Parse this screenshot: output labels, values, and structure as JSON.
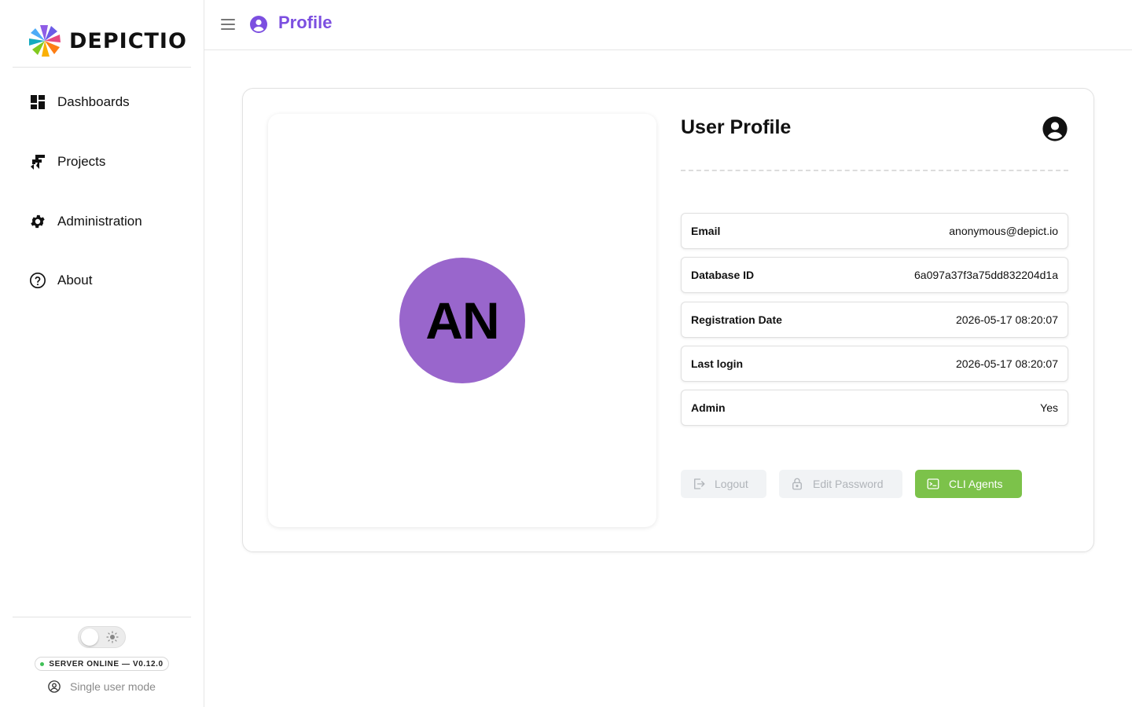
{
  "brand": {
    "name": "DEPICTIO"
  },
  "header": {
    "title": "Profile"
  },
  "sidebar": {
    "items": [
      {
        "label": "Dashboards",
        "icon": "dashboard-icon"
      },
      {
        "label": "Projects",
        "icon": "projects-icon"
      },
      {
        "label": "Administration",
        "icon": "gear-icon"
      },
      {
        "label": "About",
        "icon": "help-circle-icon"
      }
    ],
    "footer": {
      "server_status": "SERVER ONLINE — V0.12.0",
      "user_mode": "Single user mode"
    }
  },
  "profile": {
    "initials": "AN",
    "title": "User Profile",
    "fields": [
      {
        "label": "Email",
        "value": "anonymous@depict.io"
      },
      {
        "label": "Database ID",
        "value": "6a097a37f3a75dd832204d1a"
      },
      {
        "label": "Registration Date",
        "value": "2026-05-17 08:20:07"
      },
      {
        "label": "Last login",
        "value": "2026-05-17 08:20:07"
      },
      {
        "label": "Admin",
        "value": "Yes"
      }
    ],
    "buttons": {
      "logout": "Logout",
      "edit_password": "Edit Password",
      "cli_agents": "CLI Agents"
    }
  },
  "colors": {
    "accent": "#7c4fe0",
    "avatar_bg": "#9966cc",
    "cli_button": "#7cc24a",
    "status_online": "#40c057"
  }
}
